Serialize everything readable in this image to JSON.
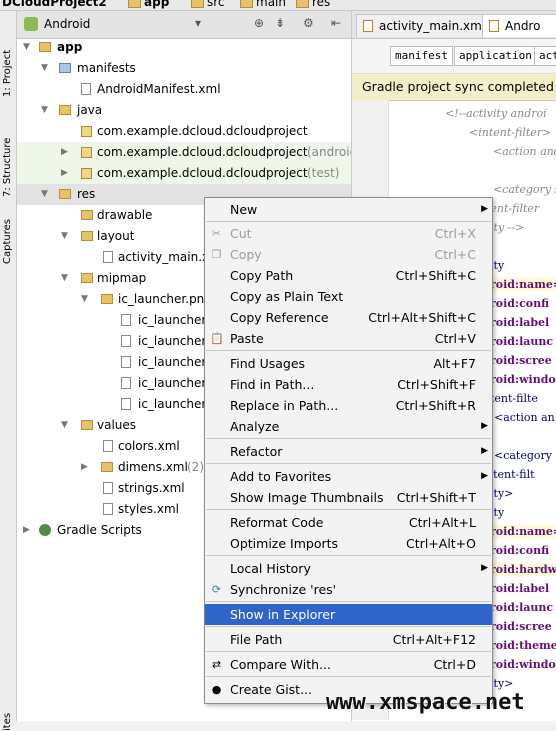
{
  "breadcrumb": [
    "DCloudProject2",
    "app",
    "src",
    "main",
    "res"
  ],
  "left_strip": [
    "1: Project",
    "7: Structure",
    "Captures",
    "ites"
  ],
  "panel": {
    "title": "Android",
    "tree": [
      {
        "label": "app",
        "extra": ""
      },
      {
        "label": "manifests",
        "extra": ""
      },
      {
        "label": "AndroidManifest.xml",
        "extra": ""
      },
      {
        "label": "java",
        "extra": ""
      },
      {
        "label": "com.example.dcloud.dcloudproject",
        "extra": ""
      },
      {
        "label": "com.example.dcloud.dcloudproject",
        "extra": "(androic"
      },
      {
        "label": "com.example.dcloud.dcloudproject",
        "extra": "(test)"
      },
      {
        "label": "res",
        "extra": ""
      },
      {
        "label": "drawable",
        "extra": ""
      },
      {
        "label": "layout",
        "extra": ""
      },
      {
        "label": "activity_main.xml",
        "extra": ""
      },
      {
        "label": "mipmap",
        "extra": ""
      },
      {
        "label": "ic_launcher.png",
        "extra": ""
      },
      {
        "label": "ic_launcher.",
        "extra": ""
      },
      {
        "label": "ic_launcher.",
        "extra": ""
      },
      {
        "label": "ic_launcher.",
        "extra": ""
      },
      {
        "label": "ic_launcher.",
        "extra": ""
      },
      {
        "label": "ic_launcher.",
        "extra": ""
      },
      {
        "label": "values",
        "extra": ""
      },
      {
        "label": "colors.xml",
        "extra": ""
      },
      {
        "label": "dimens.xml",
        "extra": "(2)"
      },
      {
        "label": "strings.xml",
        "extra": ""
      },
      {
        "label": "styles.xml",
        "extra": ""
      },
      {
        "label": "Gradle Scripts",
        "extra": ""
      }
    ]
  },
  "editor": {
    "tabs": [
      "activity_main.xml",
      "Andro"
    ],
    "xml_tags": [
      "manifest",
      "application",
      "acti"
    ],
    "notification": "Gradle project sync completed wi",
    "code_lines": [
      "<!--activity androi",
      "<intent-filter>",
      "<action and",
      "<category s",
      "tent-filter",
      "ity -->",
      "ity",
      "roid:name=",
      "roid:confi",
      "roid:label",
      "roid:launc",
      "roid:scree",
      "roid:windo",
      "tent-filte",
      "<action an",
      "<category",
      "ntent-filt",
      "ity>",
      "ity",
      "roid:name=",
      "roid:confi",
      "roid:hardw",
      "roid:label",
      "roid:launc",
      "roid:scree",
      "roid:theme",
      "roid:windo",
      "ity>"
    ]
  },
  "context_menu": {
    "items": [
      {
        "label": "New",
        "shortcut": "",
        "submenu": true,
        "disabled": false
      },
      {
        "label": "Cut",
        "shortcut": "Ctrl+X",
        "submenu": false,
        "disabled": true
      },
      {
        "label": "Copy",
        "shortcut": "Ctrl+C",
        "submenu": false,
        "disabled": true
      },
      {
        "label": "Copy Path",
        "shortcut": "Ctrl+Shift+C",
        "submenu": false,
        "disabled": false
      },
      {
        "label": "Copy as Plain Text",
        "shortcut": "",
        "submenu": false,
        "disabled": false
      },
      {
        "label": "Copy Reference",
        "shortcut": "Ctrl+Alt+Shift+C",
        "submenu": false,
        "disabled": false
      },
      {
        "label": "Paste",
        "shortcut": "Ctrl+V",
        "submenu": false,
        "disabled": false
      },
      {
        "label": "Find Usages",
        "shortcut": "Alt+F7",
        "submenu": false,
        "disabled": false
      },
      {
        "label": "Find in Path...",
        "shortcut": "Ctrl+Shift+F",
        "submenu": false,
        "disabled": false
      },
      {
        "label": "Replace in Path...",
        "shortcut": "Ctrl+Shift+R",
        "submenu": false,
        "disabled": false
      },
      {
        "label": "Analyze",
        "shortcut": "",
        "submenu": true,
        "disabled": false
      },
      {
        "label": "Refactor",
        "shortcut": "",
        "submenu": true,
        "disabled": false
      },
      {
        "label": "Add to Favorites",
        "shortcut": "",
        "submenu": true,
        "disabled": false
      },
      {
        "label": "Show Image Thumbnails",
        "shortcut": "Ctrl+Shift+T",
        "submenu": false,
        "disabled": false
      },
      {
        "label": "Reformat Code",
        "shortcut": "Ctrl+Alt+L",
        "submenu": false,
        "disabled": false
      },
      {
        "label": "Optimize Imports",
        "shortcut": "Ctrl+Alt+O",
        "submenu": false,
        "disabled": false
      },
      {
        "label": "Local History",
        "shortcut": "",
        "submenu": true,
        "disabled": false
      },
      {
        "label": "Synchronize 'res'",
        "shortcut": "",
        "submenu": false,
        "disabled": false
      },
      {
        "label": "Show in Explorer",
        "shortcut": "",
        "submenu": false,
        "disabled": false
      },
      {
        "label": "File Path",
        "shortcut": "Ctrl+Alt+F12",
        "submenu": false,
        "disabled": false
      },
      {
        "label": "Compare With...",
        "shortcut": "Ctrl+D",
        "submenu": false,
        "disabled": false
      },
      {
        "label": "Create Gist...",
        "shortcut": "",
        "submenu": false,
        "disabled": false
      }
    ],
    "active_item": "Show in Explorer"
  },
  "colors": {
    "menu_highlight": "#2f65ca",
    "notification_bg": "#f4eec8",
    "folder": "#e6c36b"
  },
  "watermark": "www.xmspace.net"
}
